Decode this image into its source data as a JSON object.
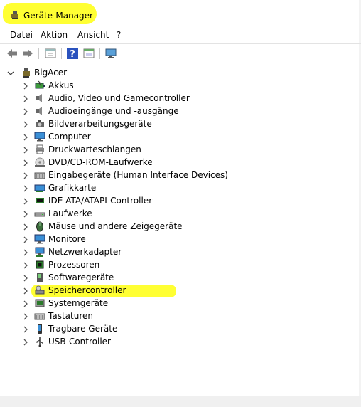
{
  "window": {
    "title": "Geräte-Manager",
    "highlight_color": "#ffff33"
  },
  "menu": [
    "Datei",
    "Aktion",
    "Ansicht",
    "?"
  ],
  "toolbar": {
    "buttons": [
      "back-arrow-icon",
      "forward-arrow-icon",
      "properties-icon",
      "help-icon",
      "view-icon",
      "monitor-scan-icon"
    ]
  },
  "tree": {
    "root": {
      "label": "BigAcer",
      "icon": "computer-tower-icon"
    },
    "categories": [
      {
        "label": "Akkus",
        "icon": "battery-icon"
      },
      {
        "label": "Audio, Video und Gamecontroller",
        "icon": "speaker-icon"
      },
      {
        "label": "Audioeingänge und -ausgänge",
        "icon": "speaker-icon"
      },
      {
        "label": "Bildverarbeitungsgeräte",
        "icon": "camera-icon"
      },
      {
        "label": "Computer",
        "icon": "monitor-icon"
      },
      {
        "label": "Druckwarteschlangen",
        "icon": "printer-icon"
      },
      {
        "label": "DVD/CD-ROM-Laufwerke",
        "icon": "disc-drive-icon"
      },
      {
        "label": "Eingabegeräte (Human Interface Devices)",
        "icon": "keyboard-icon"
      },
      {
        "label": "Grafikkarte",
        "icon": "graphics-card-icon"
      },
      {
        "label": "IDE ATA/ATAPI-Controller",
        "icon": "ide-controller-icon"
      },
      {
        "label": "Laufwerke",
        "icon": "drive-icon"
      },
      {
        "label": "Mäuse und andere Zeigegeräte",
        "icon": "mouse-icon",
        "highlighted": true
      },
      {
        "label": "Monitore",
        "icon": "monitor-icon"
      },
      {
        "label": "Netzwerkadapter",
        "icon": "network-icon"
      },
      {
        "label": "Prozessoren",
        "icon": "processor-icon"
      },
      {
        "label": "Softwaregeräte",
        "icon": "software-device-icon"
      },
      {
        "label": "Speichercontroller",
        "icon": "storage-controller-icon"
      },
      {
        "label": "Systemgeräte",
        "icon": "system-device-icon"
      },
      {
        "label": "Tastaturen",
        "icon": "keyboard-icon"
      },
      {
        "label": "Tragbare Geräte",
        "icon": "portable-device-icon"
      },
      {
        "label": "USB-Controller",
        "icon": "usb-icon"
      }
    ]
  }
}
